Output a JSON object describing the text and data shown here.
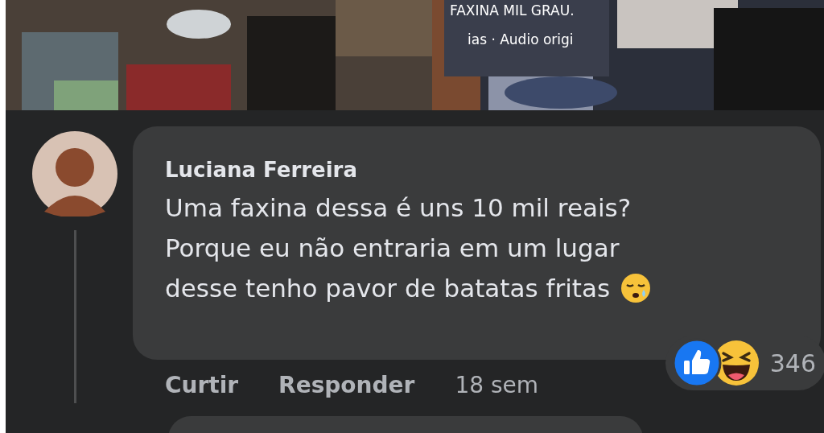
{
  "video": {
    "caption": "FAXINA MIL GRAU.",
    "audio": "ias · Audio origi"
  },
  "comment": {
    "author": "Luciana Ferreira",
    "lines": [
      "Uma faxina dessa é uns 10 mil reais?",
      "Porque eu não entraria em um lugar",
      "desse tenho pavor de batatas fritas"
    ],
    "reaction_count": "346",
    "actions": [
      "Curtir",
      "Responder"
    ],
    "time": "18 sem"
  }
}
